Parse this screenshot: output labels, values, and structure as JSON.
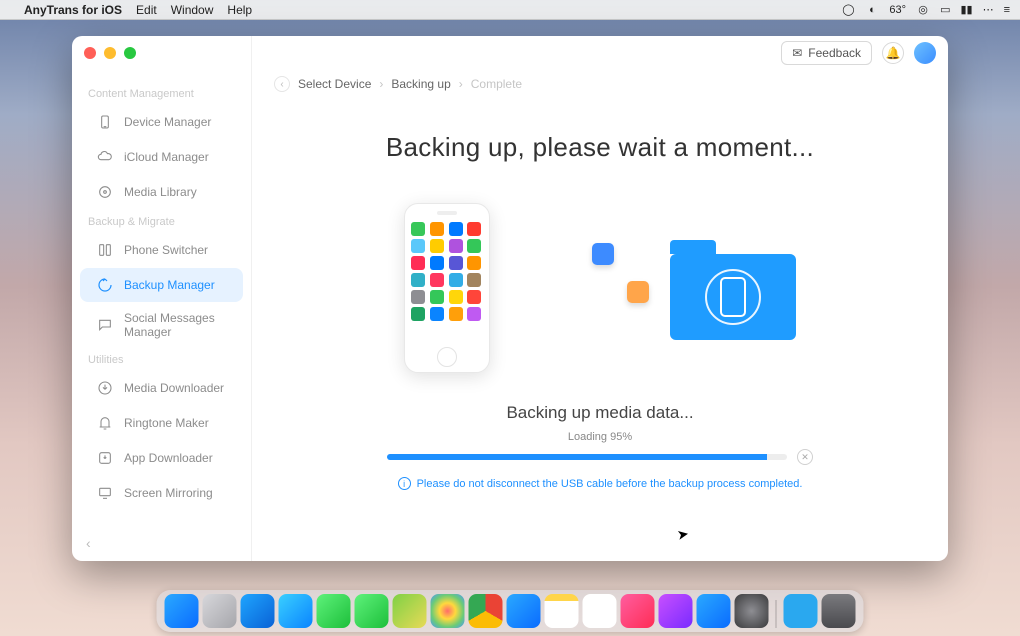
{
  "menubar": {
    "app": "AnyTrans for iOS",
    "items": [
      "Edit",
      "Window",
      "Help"
    ],
    "right_status": "63°"
  },
  "window": {
    "feedback_label": "Feedback"
  },
  "sidebar": {
    "sections": [
      {
        "title": "Content Management",
        "items": [
          {
            "icon": "device",
            "label": "Device Manager"
          },
          {
            "icon": "cloud",
            "label": "iCloud Manager"
          },
          {
            "icon": "media",
            "label": "Media Library"
          }
        ]
      },
      {
        "title": "Backup & Migrate",
        "items": [
          {
            "icon": "switch",
            "label": "Phone Switcher"
          },
          {
            "icon": "backup",
            "label": "Backup Manager",
            "active": true
          },
          {
            "icon": "chat",
            "label": "Social Messages Manager"
          }
        ]
      },
      {
        "title": "Utilities",
        "items": [
          {
            "icon": "download",
            "label": "Media Downloader"
          },
          {
            "icon": "ring",
            "label": "Ringtone Maker"
          },
          {
            "icon": "appdl",
            "label": "App Downloader"
          },
          {
            "icon": "mirror",
            "label": "Screen Mirroring"
          }
        ]
      }
    ]
  },
  "breadcrumb": {
    "items": [
      "Select Device",
      "Backing up",
      "Complete"
    ],
    "active_index": 1
  },
  "main": {
    "heading": "Backing up, please wait a moment...",
    "status": "Backing up media data...",
    "loading_prefix": "Loading ",
    "percent": 95,
    "percent_suffix": "%",
    "warning": "Please do not disconnect the USB cable before the backup process completed."
  },
  "phone_icon_colors": [
    "#37c759",
    "#ff9500",
    "#007aff",
    "#ff3b30",
    "#5ac8fa",
    "#ffcc00",
    "#af52de",
    "#34c759",
    "#ff2d55",
    "#007aff",
    "#5856d6",
    "#ff9500",
    "#30b0c7",
    "#ff375f",
    "#32ade6",
    "#a2845e",
    "#8e8e93",
    "#34c759",
    "#ffd60a",
    "#ff453a",
    "#1ea362",
    "#0a84ff",
    "#ff9f0a",
    "#bf5af2"
  ],
  "dock": [
    {
      "name": "finder",
      "bg": "linear-gradient(135deg,#2aa9ff,#0a6cff)"
    },
    {
      "name": "launchpad",
      "bg": "linear-gradient(135deg,#d7d7db,#a6a6ab)"
    },
    {
      "name": "safari",
      "bg": "linear-gradient(135deg,#1fa5ff,#0962d6)"
    },
    {
      "name": "mail",
      "bg": "linear-gradient(135deg,#3ad0ff,#0a84ff)"
    },
    {
      "name": "messages",
      "bg": "linear-gradient(135deg,#5ef27b,#1dbf3a)"
    },
    {
      "name": "facetime",
      "bg": "linear-gradient(135deg,#5ef27b,#1dbf3a)"
    },
    {
      "name": "maps",
      "bg": "linear-gradient(135deg,#7fd145,#e8da57)"
    },
    {
      "name": "photos",
      "bg": "radial-gradient(circle,#ff6b6b,#ffd93d,#6bcB77,#4d96ff)"
    },
    {
      "name": "chrome",
      "bg": "conic-gradient(#ea4335 0 120deg,#fbbc05 120deg 240deg,#34a853 240deg 360deg)"
    },
    {
      "name": "anytrans",
      "bg": "linear-gradient(135deg,#2aa9ff,#0a6cff)"
    },
    {
      "name": "notes",
      "bg": "linear-gradient(180deg,#ffd54a 0 20%,#fff 20%)"
    },
    {
      "name": "reminders",
      "bg": "#fff"
    },
    {
      "name": "music",
      "bg": "linear-gradient(135deg,#ff5ea0,#ff2d55)"
    },
    {
      "name": "podcasts",
      "bg": "linear-gradient(135deg,#c850ff,#7a2bff)"
    },
    {
      "name": "appstore",
      "bg": "linear-gradient(135deg,#2aa9ff,#0a6cff)"
    },
    {
      "name": "settings",
      "bg": "radial-gradient(circle,#8e8e93,#3a3a3c)"
    }
  ]
}
